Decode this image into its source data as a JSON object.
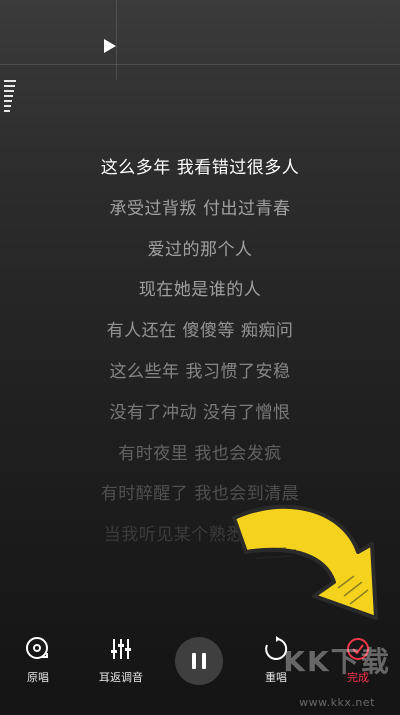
{
  "lyrics": [
    {
      "text": "这么多年 我看错过很多人",
      "opacity": 1.0
    },
    {
      "text": "承受过背叛 付出过青春",
      "opacity": 0.55
    },
    {
      "text": "爱过的那个人",
      "opacity": 0.55
    },
    {
      "text": "现在她是谁的人",
      "opacity": 0.55
    },
    {
      "text": "有人还在 傻傻等 痴痴问",
      "opacity": 0.5
    },
    {
      "text": "这么些年 我习惯了安稳",
      "opacity": 0.45
    },
    {
      "text": "没有了冲动 没有了憎恨",
      "opacity": 0.4
    },
    {
      "text": "有时夜里 我也会发疯",
      "opacity": 0.3
    },
    {
      "text": "有时醉醒了 我也会到清晨",
      "opacity": 0.22
    },
    {
      "text": "当我听见某个熟悉的声音",
      "opacity": 0.14
    }
  ],
  "toolbar": {
    "original_label": "原唱",
    "eq_label": "耳返调音",
    "replay_label": "重唱",
    "done_label": "完成"
  },
  "watermark": {
    "logo": "KK下载",
    "url": "www.kkx.net"
  },
  "colors": {
    "accent": "#f0364a",
    "arrow": "#f5d21c"
  },
  "icons": {
    "original": "vinyl-disc-icon",
    "eq": "equalizer-sliders-icon",
    "pause": "pause-icon",
    "replay": "replay-icon",
    "done": "check-circle-icon",
    "play": "play-icon"
  }
}
